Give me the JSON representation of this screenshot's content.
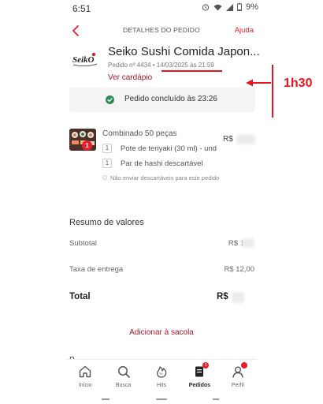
{
  "status_bar": {
    "time": "6:51",
    "battery": "9%"
  },
  "header": {
    "title": "DETALHES DO PEDIDO",
    "help": "Ajuda"
  },
  "store": {
    "logo_text": "SeikO",
    "name": "Seiko Sushi Comida Japon...",
    "order_meta": "Pedido nº 4434 • 14/03/2025 às 21:59",
    "menu_link": "Ver cardápio"
  },
  "annotation": {
    "text": "1h30",
    "color": "#e8141e"
  },
  "order_status": {
    "text": "Pedido concluído às 23:26",
    "icon": "check-circle-icon"
  },
  "item": {
    "quantity": "1",
    "name": "Combinado 50 peças",
    "price": "R$",
    "addons": [
      {
        "qty": "1",
        "name": "Pote de teriyaki (30 ml) - und"
      },
      {
        "qty": "1",
        "name": "Par de hashi descartável"
      }
    ],
    "disposable_note": "Não enviar descartáveis para este pedido"
  },
  "summary": {
    "title": "Resumo de valores",
    "subtotal_label": "Subtotal",
    "subtotal_value": "R$ 1",
    "delivery_label": "Taxa de entrega",
    "delivery_value": "R$ 12,00",
    "total_label": "Total",
    "total_value": "R$"
  },
  "add_to_cart": "Adicionar à sacola",
  "cut_title": "P",
  "nav": {
    "items": [
      {
        "label": "Início",
        "icon": "home-icon"
      },
      {
        "label": "Busca",
        "icon": "search-icon"
      },
      {
        "label": "Hits",
        "icon": "hits-icon"
      },
      {
        "label": "Pedidos",
        "icon": "orders-icon",
        "badge": "1"
      },
      {
        "label": "Perfil",
        "icon": "profile-icon"
      }
    ]
  },
  "colors": {
    "brand": "#ea1d2c",
    "link": "#a6192e",
    "status_ok": "#2e8b57"
  }
}
